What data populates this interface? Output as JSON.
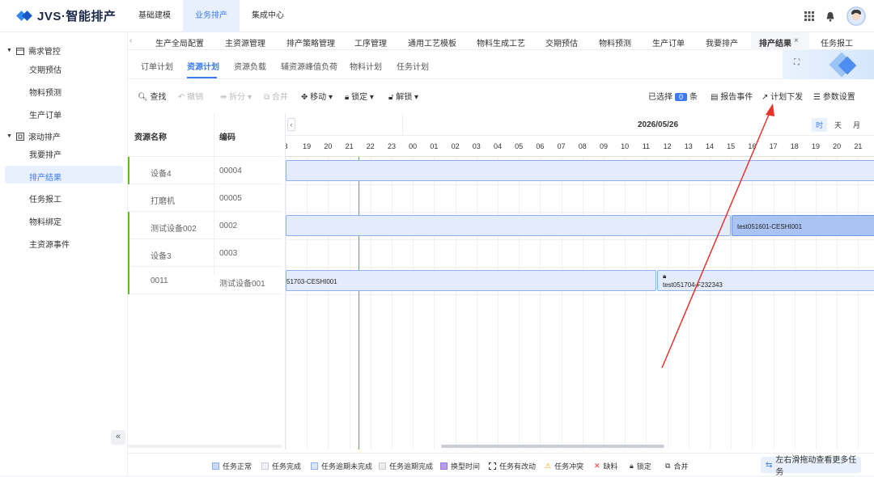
{
  "app": {
    "logo": "JVS·智能排产"
  },
  "topnav": [
    {
      "label": "基础建模"
    },
    {
      "label": "业务排产"
    },
    {
      "label": "集成中心"
    }
  ],
  "sidebar": {
    "groups": [
      {
        "label": "需求管控",
        "items": [
          {
            "label": "交期预估"
          },
          {
            "label": "物料预测"
          },
          {
            "label": "生产订单"
          }
        ]
      },
      {
        "label": "滚动排产",
        "items": [
          {
            "label": "我要排产"
          },
          {
            "label": "排产结果"
          },
          {
            "label": "任务报工"
          },
          {
            "label": "物料绑定"
          },
          {
            "label": "主资源事件"
          }
        ]
      }
    ],
    "collapse_glyph": "«"
  },
  "tabs": [
    {
      "label": "生产全局配置"
    },
    {
      "label": "主资源管理"
    },
    {
      "label": "排产策略管理"
    },
    {
      "label": "工序管理"
    },
    {
      "label": "通用工艺模板"
    },
    {
      "label": "物料生成工艺"
    },
    {
      "label": "交期预估"
    },
    {
      "label": "物料预测"
    },
    {
      "label": "生产订单"
    },
    {
      "label": "我要排产"
    },
    {
      "label": "排产结果"
    },
    {
      "label": "任务报工"
    }
  ],
  "subtabs": [
    {
      "label": "订单计划"
    },
    {
      "label": "资源计划"
    },
    {
      "label": "资源负载"
    },
    {
      "label": "辅资源峰值负荷"
    },
    {
      "label": "物料计划"
    },
    {
      "label": "任务计划"
    }
  ],
  "toolbar": {
    "search": "查找",
    "undo": "撤销",
    "split": "拆分",
    "merge": "合并",
    "move": "移动",
    "lock": "锁定",
    "unlock": "解锁",
    "selected_prefix": "已选择",
    "selected_count": "0",
    "selected_suffix": "条",
    "report": "报告事件",
    "dispatch": "计划下发",
    "settings": "参数设置"
  },
  "grid": {
    "col_name": "资源名称",
    "col_code": "编码",
    "rows": [
      {
        "name": "设备4",
        "code": "00004"
      },
      {
        "name": "打磨机",
        "code": "00005"
      },
      {
        "name": "测试设备002",
        "code": "0002"
      },
      {
        "name": "设备3",
        "code": "0003"
      },
      {
        "name": "0011",
        "code": "测试设备001"
      }
    ]
  },
  "gantt": {
    "date": "2026/05/26",
    "views": [
      {
        "label": "时"
      },
      {
        "label": "天"
      },
      {
        "label": "月"
      }
    ],
    "hours": [
      "8",
      "19",
      "20",
      "21",
      "22",
      "23",
      "00",
      "01",
      "02",
      "03",
      "04",
      "05",
      "06",
      "07",
      "08",
      "09",
      "10",
      "11",
      "12",
      "13",
      "14",
      "15",
      "16",
      "17",
      "18",
      "19",
      "20",
      "21"
    ],
    "tasks": [
      {
        "label": "test051601-CESHI001"
      },
      {
        "label": "51703-CESHI001"
      },
      {
        "label": "test051704-F232343"
      }
    ]
  },
  "legend": {
    "items": [
      {
        "label": "任务正常"
      },
      {
        "label": "任务完成"
      },
      {
        "label": "任务逾期未完成"
      },
      {
        "label": "任务逾期完成"
      },
      {
        "label": "换型时间"
      },
      {
        "label": "任务有改动"
      },
      {
        "label": "任务冲突"
      },
      {
        "label": "缺料"
      },
      {
        "label": "锁定"
      },
      {
        "label": "合并"
      }
    ],
    "hint": "左右滑拖动查看更多任务"
  },
  "colors": {
    "accent": "#3b7cf5",
    "annotation": "#e8332c",
    "resource_marker": "#52c41a"
  }
}
